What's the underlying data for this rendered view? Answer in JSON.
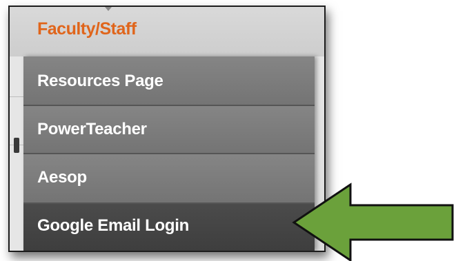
{
  "menu": {
    "header": "Faculty/Staff",
    "items": [
      {
        "label": "Resources Page"
      },
      {
        "label": "PowerTeacher"
      },
      {
        "label": "Aesop"
      },
      {
        "label": "Google Email Login"
      }
    ]
  },
  "colors": {
    "header_text": "#e0651b",
    "menu_bg": "#7a7a7a",
    "menu_active_bg": "#434343",
    "arrow_fill": "#6ba13b",
    "arrow_stroke": "#111111"
  },
  "icons": {
    "pointer": "arrow-left-icon"
  }
}
